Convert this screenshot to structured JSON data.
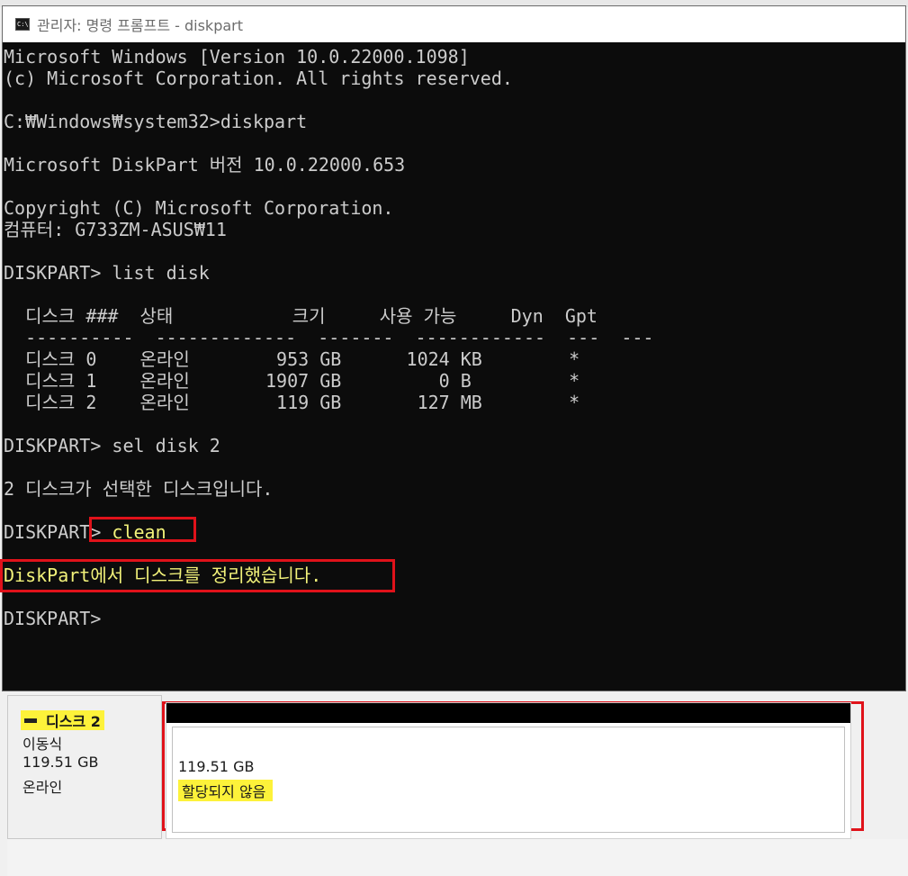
{
  "window": {
    "title": "관리자: 명령 프롬프트 - diskpart",
    "icon": "cmd-icon"
  },
  "console": {
    "lines": [
      "Microsoft Windows [Version 10.0.22000.1098]",
      "(c) Microsoft Corporation. All rights reserved.",
      "",
      "C:₩Windows₩system32>diskpart",
      "",
      "Microsoft DiskPart 버전 10.0.22000.653",
      "",
      "Copyright (C) Microsoft Corporation.",
      "컴퓨터: G733ZM-ASUS₩11",
      "",
      "DISKPART> list disk",
      "",
      "  디스크 ###  상태           크기     사용 가능     Dyn  Gpt",
      "  ----------  -------------  -------  ------------  ---  ---",
      "  디스크 0    온라인        953 GB      1024 KB        *",
      "  디스크 1    온라인       1907 GB         0 B         *",
      "  디스크 2    온라인        119 GB       127 MB        *",
      "",
      "DISKPART> sel disk 2",
      "",
      "2 디스크가 선택한 디스크입니다.",
      "",
      "DISKPART> clean",
      "",
      "DiskPart에서 디스크를 정리했습니다.",
      "",
      "DISKPART>"
    ],
    "yellow_prefixes": {
      "22": 10
    },
    "yellow_lines": [
      24
    ]
  },
  "disk_panel": {
    "disk_name": "디스크 2",
    "disk_type": "이동식",
    "disk_size": "119.51 GB",
    "disk_status": "온라인",
    "volume_size": "119.51 GB",
    "volume_status": "할당되지 않음"
  },
  "colors": {
    "console_bg": "#0c0c0c",
    "console_text": "#cccccc",
    "highlight_text": "#f2f27a",
    "annotation_red": "#e0121a",
    "marker_yellow": "#fdf23a"
  }
}
